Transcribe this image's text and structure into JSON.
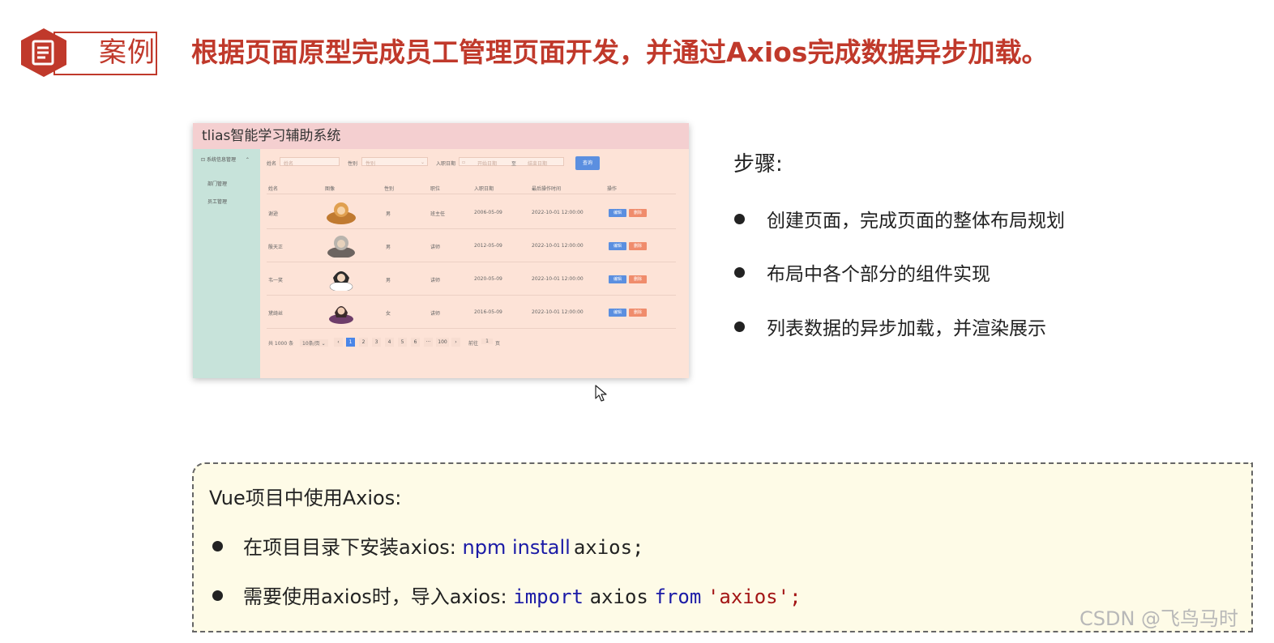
{
  "header": {
    "badge_label": "案例",
    "headline": "根据页面原型完成员工管理页面开发，并通过Axios完成数据异步加载。"
  },
  "mockup": {
    "app_title": "tlias智能学习辅助系统",
    "sidebar": {
      "group": "系统信息管理",
      "items": [
        "部门管理",
        "员工管理"
      ]
    },
    "search": {
      "name_label": "姓名",
      "name_placeholder": "姓名",
      "gender_label": "性别",
      "gender_placeholder": "性别",
      "date_label": "入职日期",
      "start_placeholder": "开始日期",
      "separator": "至",
      "end_placeholder": "结束日期",
      "query_button": "查询"
    },
    "table": {
      "columns": [
        "姓名",
        "图像",
        "性别",
        "职位",
        "入职日期",
        "最后操作时间",
        "操作"
      ],
      "rows": [
        {
          "name": "谢逊",
          "gender": "男",
          "job": "班主任",
          "entry": "2006-05-09",
          "updated": "2022-10-01 12:00:00"
        },
        {
          "name": "殷天正",
          "gender": "男",
          "job": "讲师",
          "entry": "2012-05-09",
          "updated": "2022-10-01 12:00:00"
        },
        {
          "name": "韦一笑",
          "gender": "男",
          "job": "讲师",
          "entry": "2020-05-09",
          "updated": "2022-10-01 12:00:00"
        },
        {
          "name": "黛绮丝",
          "gender": "女",
          "job": "讲师",
          "entry": "2016-05-09",
          "updated": "2022-10-01 12:00:00"
        }
      ],
      "edit_label": "编辑",
      "delete_label": "删除"
    },
    "pagination": {
      "total": "共 1000 条",
      "page_size": "10条/页",
      "prev": "‹",
      "pages": [
        "1",
        "2",
        "3",
        "4",
        "5",
        "6",
        "···",
        "100"
      ],
      "next": "›",
      "goto_label": "前往",
      "goto_value": "1",
      "goto_suffix": "页"
    }
  },
  "steps": {
    "title": "步骤:",
    "items": [
      "创建页面，完成页面的整体布局规划",
      "布局中各个部分的组件实现",
      "列表数据的异步加载，并渲染展示"
    ]
  },
  "axios_box": {
    "title": "Vue项目中使用Axios:",
    "line1_text": "在项目目录下安装axios:",
    "line1_kw1": "npm",
    "line1_kw2": "install",
    "line1_rest": "axios;",
    "line2_text": "需要使用axios时，导入axios:",
    "line2_import": "import",
    "line2_name": "axios",
    "line2_from": "from",
    "line2_str": "'axios';"
  },
  "watermark": "CSDN @飞鸟马时",
  "colors": {
    "accent_red": "#c0392b",
    "keyword_blue": "#1a1aa6",
    "box_bg": "#fefbe7"
  }
}
